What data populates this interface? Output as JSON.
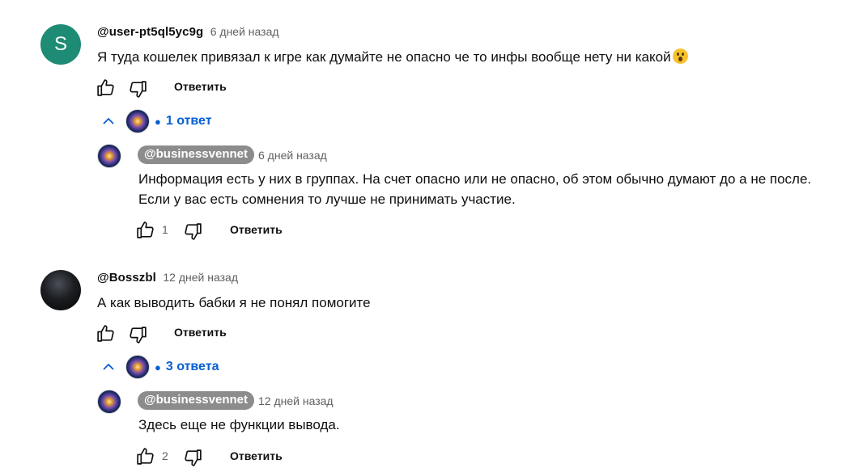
{
  "comments": [
    {
      "author": "@user-pt5ql5yc9g",
      "avatar_letter": "S",
      "time": "6 дней назад",
      "text": "Я туда кошелек привязал к игре как думайте не опасно че то инфы вообще нету ни какой",
      "emoji": "astonished-face",
      "reply_label": "Ответить",
      "replies_toggle": "1 ответ",
      "reply": {
        "author": "@businessvennet",
        "time": "6 дней назад",
        "text_lines": [
          "Информация есть у них в группах. На счет опасно или не опасно, об этом обычно думают до а не после.",
          "Если у вас есть сомнения то лучше не принимать участие."
        ],
        "likes": "1",
        "reply_label": "Ответить"
      }
    },
    {
      "author": "@Bosszbl",
      "time": "12 дней назад",
      "text": "А как выводить бабки я не понял помогите",
      "reply_label": "Ответить",
      "replies_toggle": "3 ответа",
      "reply": {
        "author": "@businessvennet",
        "time": "12 дней назад",
        "text_lines": [
          "Здесь еще не функции вывода."
        ],
        "likes": "2",
        "reply_label": "Ответить"
      }
    }
  ],
  "colors": {
    "link": "#065fd4",
    "badge": "#8c8c8c",
    "secondary_text": "#606060",
    "avatar_s": "#1e8b74"
  }
}
